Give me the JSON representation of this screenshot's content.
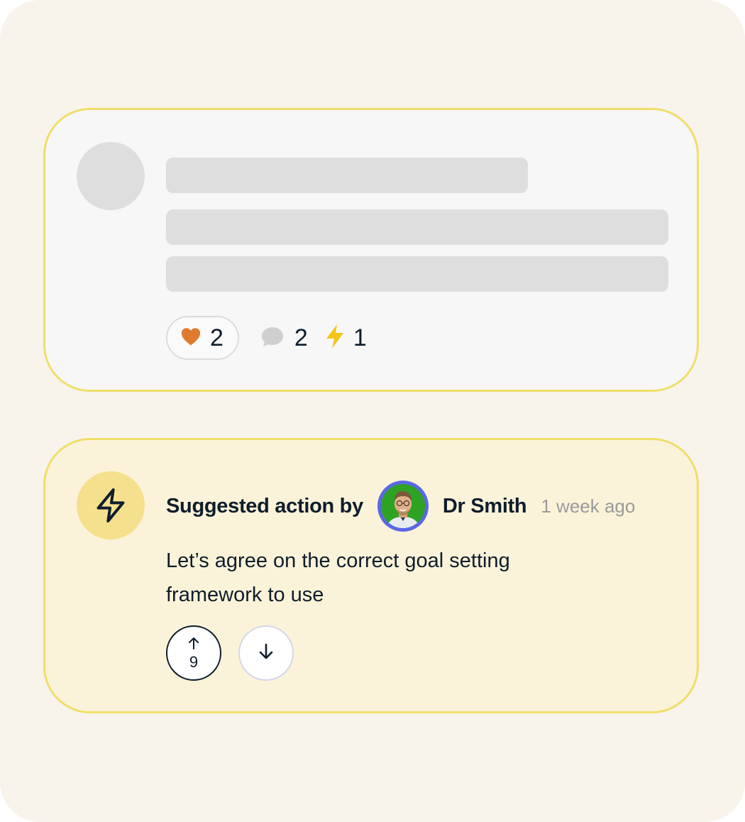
{
  "post": {
    "reactions": {
      "likes": "2",
      "comments": "2",
      "actions": "1"
    },
    "icons": {
      "like": "heart-icon",
      "comment": "comment-bubble-icon",
      "action": "lightning-bolt-icon"
    }
  },
  "suggested_action": {
    "heading": "Suggested action by",
    "author": "Dr Smith",
    "timestamp": "1 week ago",
    "text": "Let’s agree on the correct goal setting framework to use",
    "upvotes": "9",
    "icons": {
      "badge": "lightning-bolt-icon",
      "upvote": "arrow-up-icon",
      "downvote": "arrow-down-icon"
    }
  },
  "colors": {
    "background": "#f8f4ec",
    "card_border": "#f0de6a",
    "action_card_bg": "#fbf3d9",
    "heart": "#e07a2f",
    "bolt": "#f5c518",
    "text": "#0f1d2c",
    "avatar_ring": "#5b67e6"
  }
}
